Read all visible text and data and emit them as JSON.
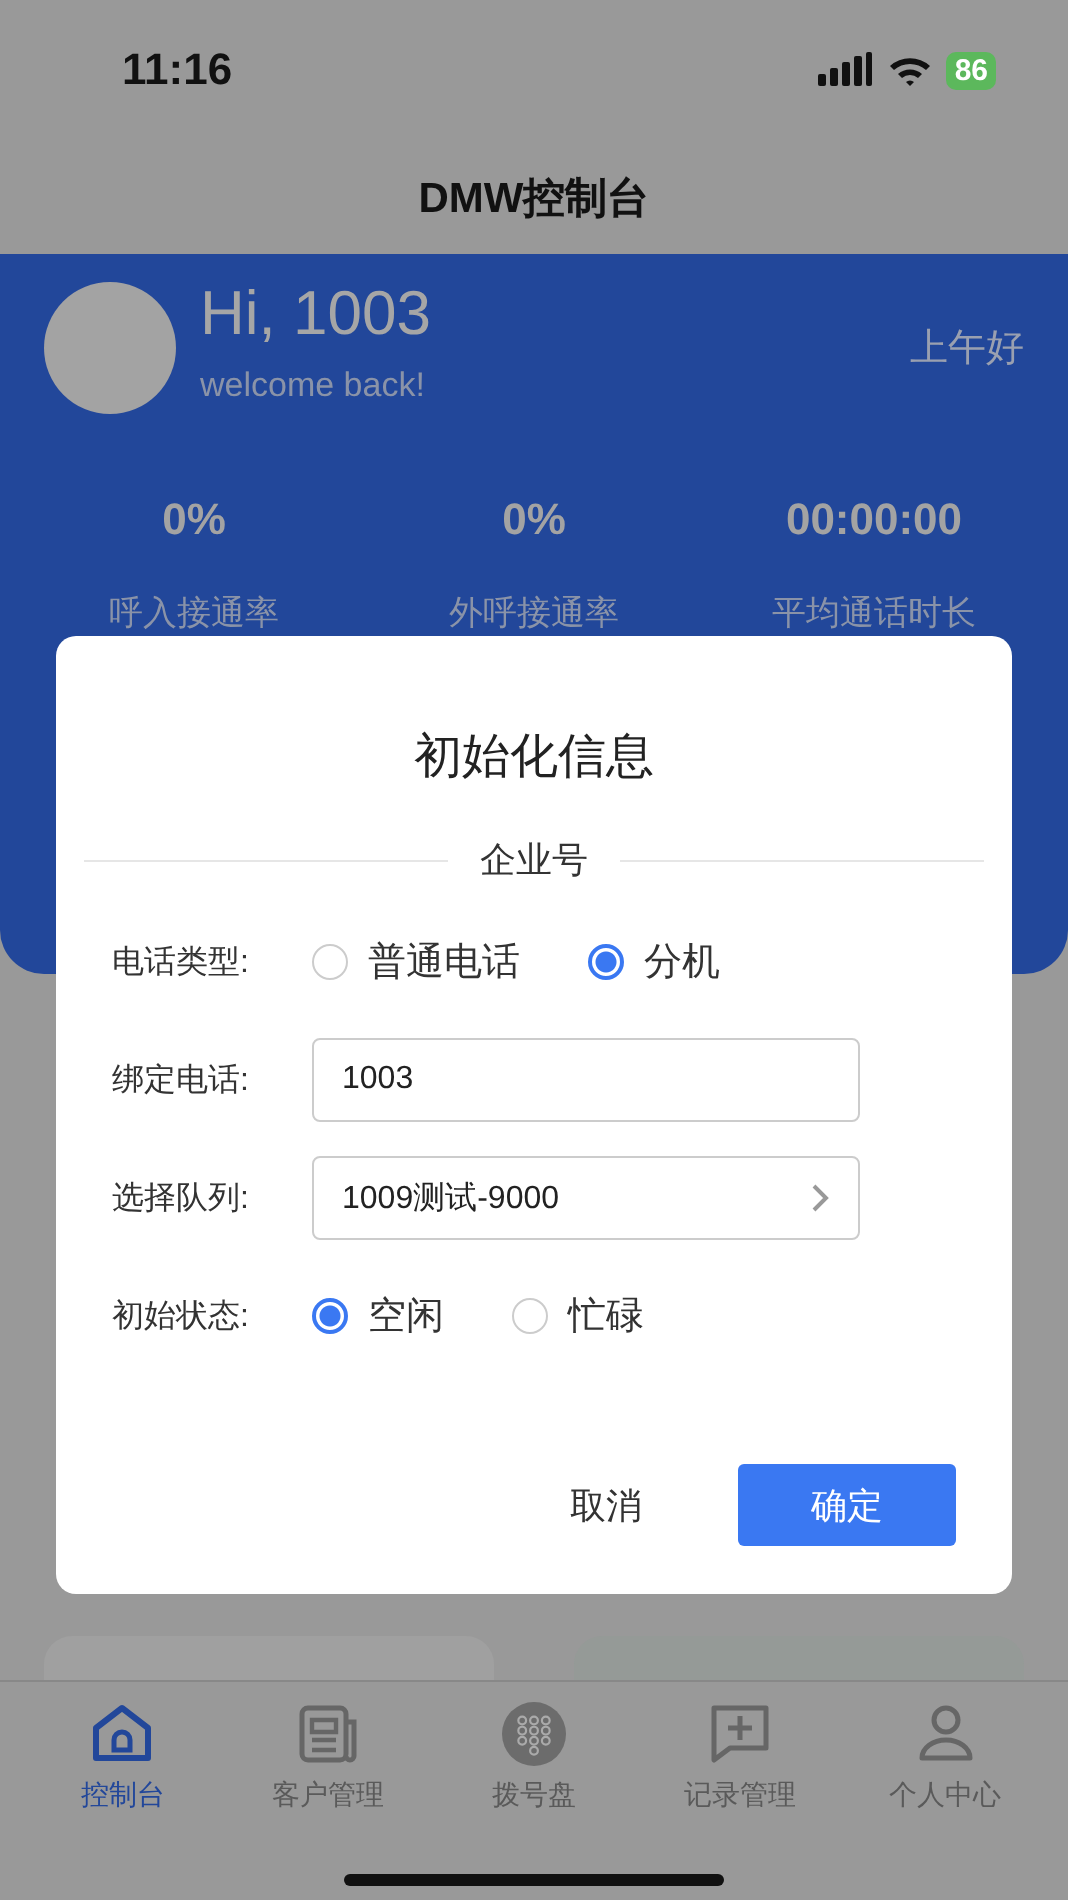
{
  "status_bar": {
    "time": "11:16",
    "battery": "86"
  },
  "nav": {
    "title": "DMW控制台"
  },
  "profile": {
    "greeting": "Hi, 1003",
    "subtitle": "welcome back!",
    "time_greeting": "上午好"
  },
  "stats": [
    {
      "value": "0%",
      "label": "呼入接通率"
    },
    {
      "value": "0%",
      "label": "外呼接通率"
    },
    {
      "value": "00:00:00",
      "label": "平均通话时长"
    }
  ],
  "dialog": {
    "title": "初始化信息",
    "section": "企业号",
    "fields": [
      {
        "kind": "radio",
        "label": "电话类型:",
        "options": [
          {
            "label": "普通电话",
            "selected": false
          },
          {
            "label": "分机",
            "selected": true
          }
        ]
      },
      {
        "kind": "input",
        "label": "绑定电话:",
        "value": "1003"
      },
      {
        "kind": "select",
        "label": "选择队列:",
        "value": "1009测试-9000"
      },
      {
        "kind": "radio",
        "label": "初始状态:",
        "options": [
          {
            "label": "空闲",
            "selected": true
          },
          {
            "label": "忙碌",
            "selected": false
          }
        ]
      }
    ],
    "buttons": [
      {
        "label": "取消",
        "kind": "secondary"
      },
      {
        "label": "确定",
        "kind": "primary"
      }
    ]
  },
  "tab_bar": [
    {
      "label": "控制台",
      "selected": true
    },
    {
      "label": "客户管理",
      "selected": false
    },
    {
      "label": "拨号盘",
      "selected": false
    },
    {
      "label": "记录管理",
      "selected": false
    },
    {
      "label": "个人中心",
      "selected": false
    }
  ]
}
